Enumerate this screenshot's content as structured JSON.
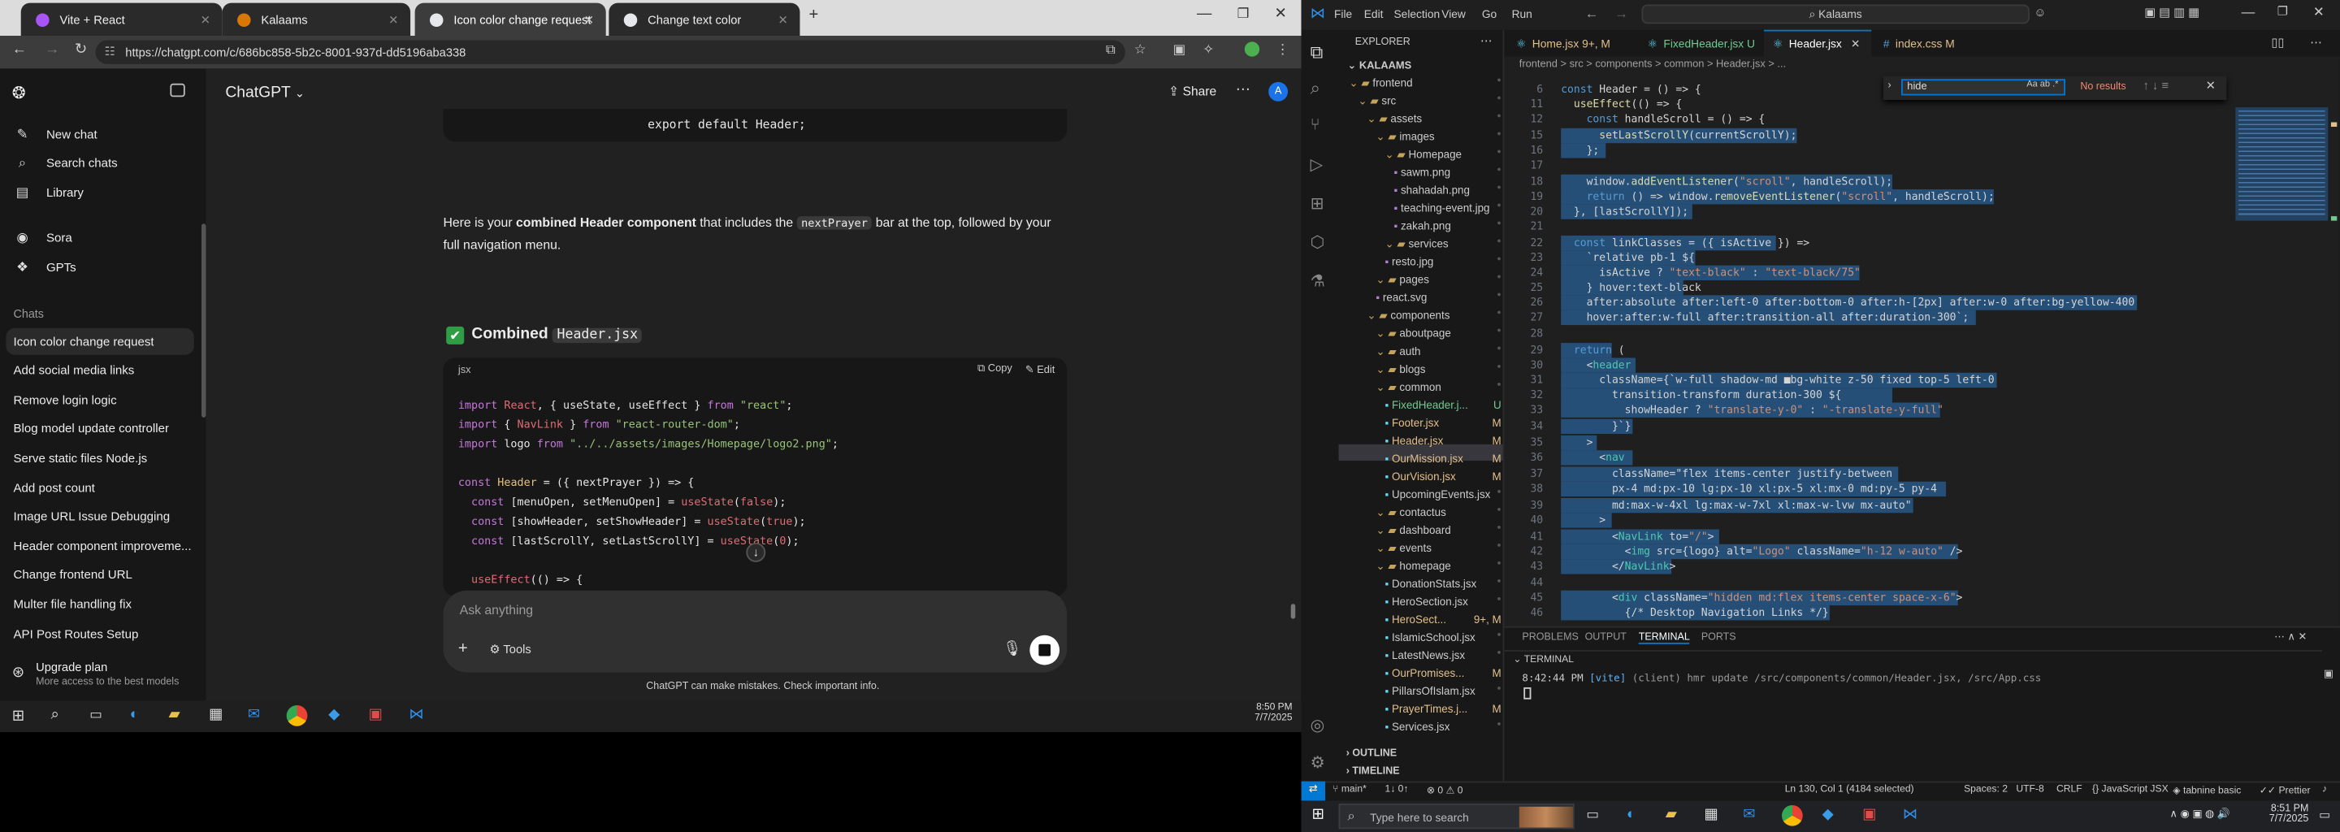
{
  "browser": {
    "tabs": [
      {
        "label": "Vite + React"
      },
      {
        "label": "Kalaams"
      },
      {
        "label": "Icon color change request"
      },
      {
        "label": "Change text color"
      }
    ],
    "url": "https://chatgpt.com/c/686bc858-5b2c-8001-937d-dd5196aba338"
  },
  "chatgpt": {
    "app_title": "ChatGPT",
    "share_label": "Share",
    "nav": [
      {
        "label": "New chat",
        "icon": "compose-icon"
      },
      {
        "label": "Search chats",
        "icon": "search-icon"
      },
      {
        "label": "Library",
        "icon": "library-icon"
      },
      {
        "label": "Sora",
        "icon": "sora-icon"
      },
      {
        "label": "GPTs",
        "icon": "gpts-icon"
      }
    ],
    "chats_heading": "Chats",
    "chats": [
      "Icon color change request",
      "Add social media links",
      "Remove login logic",
      "Blog model update controller",
      "Serve static files Node.js",
      "Add post count",
      "Image URL Issue Debugging",
      "Header component improveme...",
      "Change frontend URL",
      "Multer file handling fix",
      "API Post Routes Setup"
    ],
    "upgrade": {
      "title": "Upgrade plan",
      "subtitle": "More access to the best models"
    },
    "prev_code_tail": "export default Header;",
    "message_pre": "Here is your ",
    "message_bold": "combined Header component",
    "message_mid": " that includes the ",
    "message_code": "nextPrayer",
    "message_post": " bar at the top, followed by your full navigation menu.",
    "section_prefix": "Combined ",
    "section_file": "Header.jsx",
    "code_lang": "jsx",
    "copy_label": "Copy",
    "edit_label": "Edit",
    "composer_placeholder": "Ask anything",
    "tools_label": "Tools",
    "disclaimer": "ChatGPT can make mistakes. Check important info."
  },
  "taskbar_left": {
    "time": "8:50 PM",
    "date": "7/7/2025"
  },
  "vscode": {
    "menu": [
      "File",
      "Edit",
      "Selection",
      "View",
      "Go",
      "Run"
    ],
    "search": "Kalaams",
    "explorer_title": "EXPLORER",
    "root": "KALAAMS",
    "tabs": [
      {
        "label": "Home.jsx",
        "badge": "9+, M"
      },
      {
        "label": "FixedHeader.jsx",
        "badge": "U"
      },
      {
        "label": "Header.jsx",
        "badge": ""
      },
      {
        "label": "index.css",
        "badge": "M"
      }
    ],
    "breadcrumb": "frontend > src > components > common > Header.jsx > ...",
    "find_value": "hide",
    "find_result": "No results",
    "tree": [
      {
        "label": "frontend",
        "depth": 1,
        "folder": true
      },
      {
        "label": "src",
        "depth": 2,
        "folder": true
      },
      {
        "label": "assets",
        "depth": 3,
        "folder": true
      },
      {
        "label": "images",
        "depth": 4,
        "folder": true
      },
      {
        "label": "Homepage",
        "depth": 5,
        "folder": true
      },
      {
        "label": "sawm.png",
        "depth": 6
      },
      {
        "label": "shahadah.png",
        "depth": 6
      },
      {
        "label": "teaching-event.jpg",
        "depth": 6
      },
      {
        "label": "zakah.png",
        "depth": 6
      },
      {
        "label": "services",
        "depth": 5,
        "folder": true
      },
      {
        "label": "resto.jpg",
        "depth": 5
      },
      {
        "label": "pages",
        "depth": 4,
        "folder": true
      },
      {
        "label": "react.svg",
        "depth": 4
      },
      {
        "label": "components",
        "depth": 3,
        "folder": true
      },
      {
        "label": "aboutpage",
        "depth": 4,
        "folder": true
      },
      {
        "label": "auth",
        "depth": 4,
        "folder": true
      },
      {
        "label": "blogs",
        "depth": 4,
        "folder": true
      },
      {
        "label": "common",
        "depth": 4,
        "folder": true
      },
      {
        "label": "FixedHeader.j...",
        "depth": 5,
        "badge": "U"
      },
      {
        "label": "Footer.jsx",
        "depth": 5,
        "badge": "M"
      },
      {
        "label": "Header.jsx",
        "depth": 5,
        "badge": "M"
      },
      {
        "label": "OurMission.jsx",
        "depth": 5,
        "badge": "M"
      },
      {
        "label": "OurVision.jsx",
        "depth": 5,
        "badge": "M"
      },
      {
        "label": "UpcomingEvents.jsx",
        "depth": 5
      },
      {
        "label": "contactus",
        "depth": 4,
        "folder": true
      },
      {
        "label": "dashboard",
        "depth": 4,
        "folder": true
      },
      {
        "label": "events",
        "depth": 4,
        "folder": true
      },
      {
        "label": "homepage",
        "depth": 4,
        "folder": true
      },
      {
        "label": "DonationStats.jsx",
        "depth": 5
      },
      {
        "label": "HeroSection.jsx",
        "depth": 5
      },
      {
        "label": "HeroSect...",
        "depth": 5,
        "badge": "9+, M"
      },
      {
        "label": "IslamicSchool.jsx",
        "depth": 5
      },
      {
        "label": "LatestNews.jsx",
        "depth": 5
      },
      {
        "label": "OurPromises...",
        "depth": 5,
        "badge": "M"
      },
      {
        "label": "PillarsOfIslam.jsx",
        "depth": 5
      },
      {
        "label": "PrayerTimes.j...",
        "depth": 5,
        "badge": "M"
      },
      {
        "label": "Services.jsx",
        "depth": 5
      }
    ],
    "outline": "OUTLINE",
    "timeline": "TIMELINE",
    "panel_tabs": [
      "PROBLEMS",
      "OUTPUT",
      "TERMINAL",
      "PORTS"
    ],
    "terminal_title": "TERMINAL",
    "terminal_line_time": "8:42:44 PM",
    "terminal_line_tag": "[vite]",
    "terminal_line_rest": "(client) hmr update /src/components/common/Header.jsx, /src/App.css",
    "status": {
      "branch": "main*",
      "sync": "1↓ 0↑",
      "problems": "⊗ 0 ⚠ 0",
      "position": "Ln 130, Col 1 (4184 selected)",
      "spaces": "Spaces: 2",
      "encoding": "UTF-8",
      "eol": "CRLF",
      "lang": "JavaScript JSX",
      "tabnine": "tabnine basic",
      "prettier": "Prettier"
    }
  },
  "windows": {
    "search_placeholder": "Type here to search",
    "time": "8:51 PM",
    "date": "7/7/2025"
  }
}
